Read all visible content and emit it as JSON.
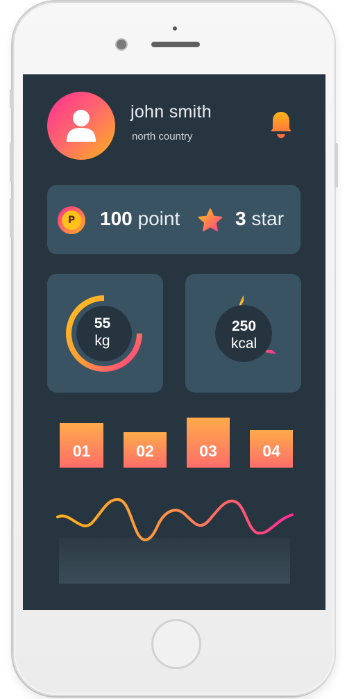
{
  "profile": {
    "name": "john smith",
    "location": "north country",
    "avatar_icon": "user-icon",
    "notification_icon": "bell-icon"
  },
  "stats": {
    "points_value": "100",
    "points_label": "point",
    "points_icon_letter": "P",
    "stars_value": "3",
    "stars_label": "star"
  },
  "rings": [
    {
      "value": "55",
      "unit": "kg"
    },
    {
      "value": "250",
      "unit": "kcal"
    }
  ],
  "tiles": [
    "01",
    "02",
    "03",
    "04"
  ],
  "colors": {
    "background": "#273540",
    "card": "#3a5363",
    "accent_pink": "#ff2d95",
    "accent_orange": "#ffb31a",
    "tile_top": "#ffab4a",
    "tile_bottom": "#ff6e6a"
  }
}
